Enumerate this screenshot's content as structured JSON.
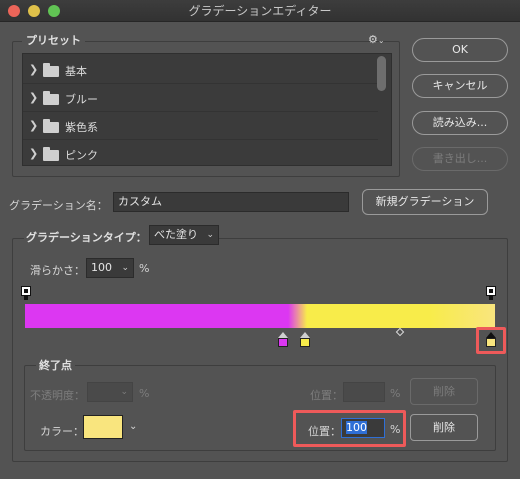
{
  "window": {
    "title": "グラデーションエディター",
    "traffic_lights": [
      "#ec6559",
      "#e0c14a",
      "#61c454"
    ]
  },
  "presets": {
    "label": "プリセット",
    "gear": "⚙",
    "items": [
      {
        "label": "基本"
      },
      {
        "label": "ブルー"
      },
      {
        "label": "紫色系"
      },
      {
        "label": "ピンク"
      }
    ]
  },
  "buttons": {
    "ok": "OK",
    "cancel": "キャンセル",
    "load": "読み込み...",
    "save": "書き出し...",
    "new_gradient": "新規グラデーション",
    "delete_opacity": "削除",
    "delete_color": "削除"
  },
  "gradient_name": {
    "label": "グラデーション名：",
    "value": "カスタム"
  },
  "gradient_type": {
    "label": "グラデーションタイプ：",
    "value": "べた塗り"
  },
  "smoothness": {
    "label": "滑らかさ：",
    "value": "100",
    "unit": "%"
  },
  "gradient": {
    "colors": {
      "magenta": "#dc37f2",
      "yellow": "#f8ec4a",
      "pale_yellow": "#f9e57e"
    },
    "color_stops": [
      {
        "color": "#dc37f2"
      },
      {
        "color": "#f8ec4a"
      },
      {
        "color": "#f9e57e"
      }
    ]
  },
  "stops": {
    "label": "終了点",
    "opacity_label": "不透明度：",
    "opacity_value": "",
    "opacity_unit": "%",
    "opacity_location_label": "位置：",
    "opacity_location_value": "",
    "opacity_location_unit": "%",
    "color_label": "カラー：",
    "color_value": "#f9e57e",
    "color_location_label": "位置：",
    "color_location_value": "100",
    "color_location_unit": "%"
  },
  "highlight_color": "#ee5a5a"
}
